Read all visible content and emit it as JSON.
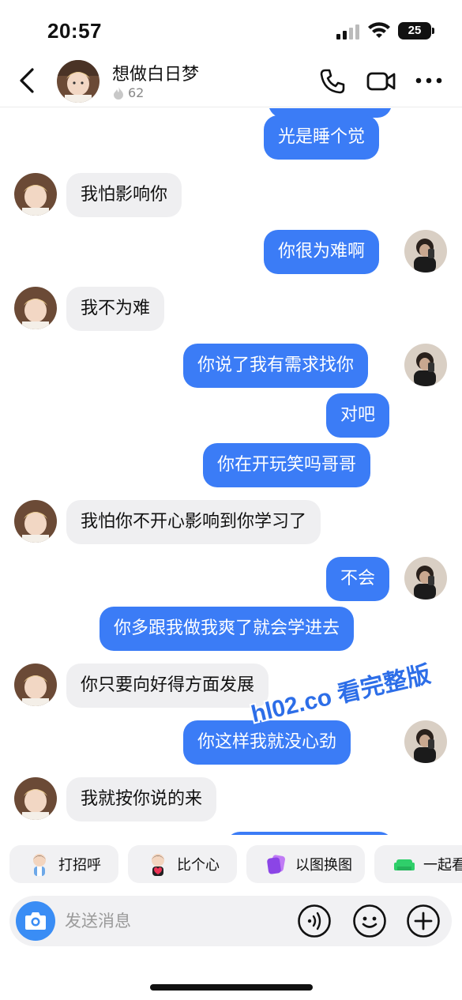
{
  "status_bar": {
    "time": "20:57",
    "battery": "25"
  },
  "header": {
    "name": "想做白日梦",
    "streak": "62",
    "icons": [
      "back-arrow-icon",
      "phone-icon",
      "video-camera-icon",
      "more-icon",
      "flame-icon"
    ]
  },
  "messages": [
    {
      "side": "out",
      "text": "光是睡个觉"
    },
    {
      "side": "in",
      "text": "我怕影响你"
    },
    {
      "side": "out",
      "text": "你很为难啊"
    },
    {
      "side": "in",
      "text": "我不为难"
    },
    {
      "side": "out",
      "text": "你说了我有需求找你"
    },
    {
      "side": "out",
      "text": "对吧"
    },
    {
      "side": "out",
      "text": "你在开玩笑吗哥哥"
    },
    {
      "side": "in",
      "text": "我怕你不开心影响到你学习了"
    },
    {
      "side": "out",
      "text": "不会"
    },
    {
      "side": "out",
      "text": "你多跟我做我爽了就会学进去"
    },
    {
      "side": "in",
      "text": "你只要向好得方面发展"
    },
    {
      "side": "out",
      "text": "你这样我就没心劲"
    },
    {
      "side": "in",
      "text": "我就按你说的来"
    }
  ],
  "watermark": "hl02.co 看完整版",
  "quick_actions": [
    {
      "label": "打招呼",
      "icon": "wave-avatar-icon"
    },
    {
      "label": "比个心",
      "icon": "heart-avatar-icon"
    },
    {
      "label": "以图换图",
      "icon": "photo-swap-icon"
    },
    {
      "label": "一起看",
      "icon": "sofa-icon"
    }
  ],
  "composer": {
    "placeholder": "发送消息"
  },
  "colors": {
    "outgoing_bubble": "#3b7cf6",
    "incoming_bubble": "#efeff1",
    "camera_button": "#3a8df5"
  }
}
